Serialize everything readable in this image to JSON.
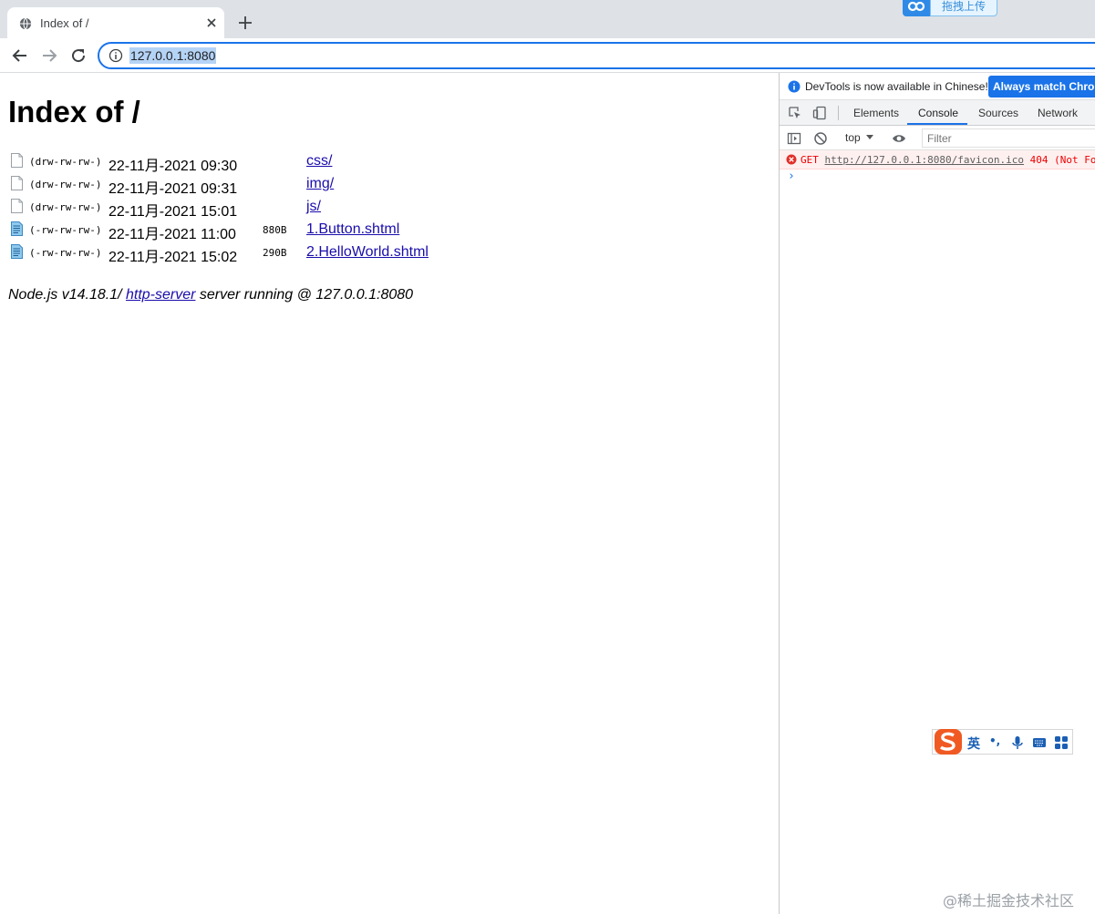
{
  "browser": {
    "tab": {
      "title": "Index of /",
      "favicon": "globe-icon"
    },
    "new_tab_icon": "plus-icon",
    "address_bar": {
      "url": "127.0.0.1:8080",
      "info_icon": "info-icon"
    },
    "extension": {
      "label": "拖拽上传",
      "icon": "baidu-netdisk-icon"
    }
  },
  "page": {
    "heading": "Index of /",
    "entries": [
      {
        "icon": "blank-file-icon",
        "permissions": "(drw-rw-rw-)",
        "date": "22-11月-2021 09:30",
        "size": "",
        "name": "css/"
      },
      {
        "icon": "blank-file-icon",
        "permissions": "(drw-rw-rw-)",
        "date": "22-11月-2021 09:31",
        "size": "",
        "name": "img/"
      },
      {
        "icon": "blank-file-icon",
        "permissions": "(drw-rw-rw-)",
        "date": "22-11月-2021 15:01",
        "size": "",
        "name": "js/"
      },
      {
        "icon": "text-file-icon",
        "permissions": "(-rw-rw-rw-)",
        "date": "22-11月-2021 11:00",
        "size": "880B",
        "name": "1.Button.shtml"
      },
      {
        "icon": "text-file-icon",
        "permissions": "(-rw-rw-rw-)",
        "date": "22-11月-2021 15:02",
        "size": "290B",
        "name": "2.HelloWorld.shtml"
      }
    ],
    "footer": {
      "prefix": "Node.js v14.18.1/ ",
      "link": "http-server",
      "suffix": " server running @ 127.0.0.1:8080"
    }
  },
  "devtools": {
    "infobar": {
      "text": "DevTools is now available in Chinese!",
      "button": "Always match Chrom"
    },
    "tabs": [
      "Elements",
      "Console",
      "Sources",
      "Network"
    ],
    "active_tab": "Console",
    "context": "top",
    "filter_placeholder": "Filter",
    "console": {
      "error": {
        "method": "GET",
        "url": "http://127.0.0.1:8080/favicon.ico",
        "status": "404 (Not Fo"
      },
      "prompt": "›"
    }
  },
  "ime": {
    "language": "英",
    "punct": "•,",
    "icons": [
      "s-logo-icon",
      "microphone-icon",
      "keyboard-icon",
      "grid-icon"
    ]
  },
  "watermark": "@稀土掘金技术社区"
}
